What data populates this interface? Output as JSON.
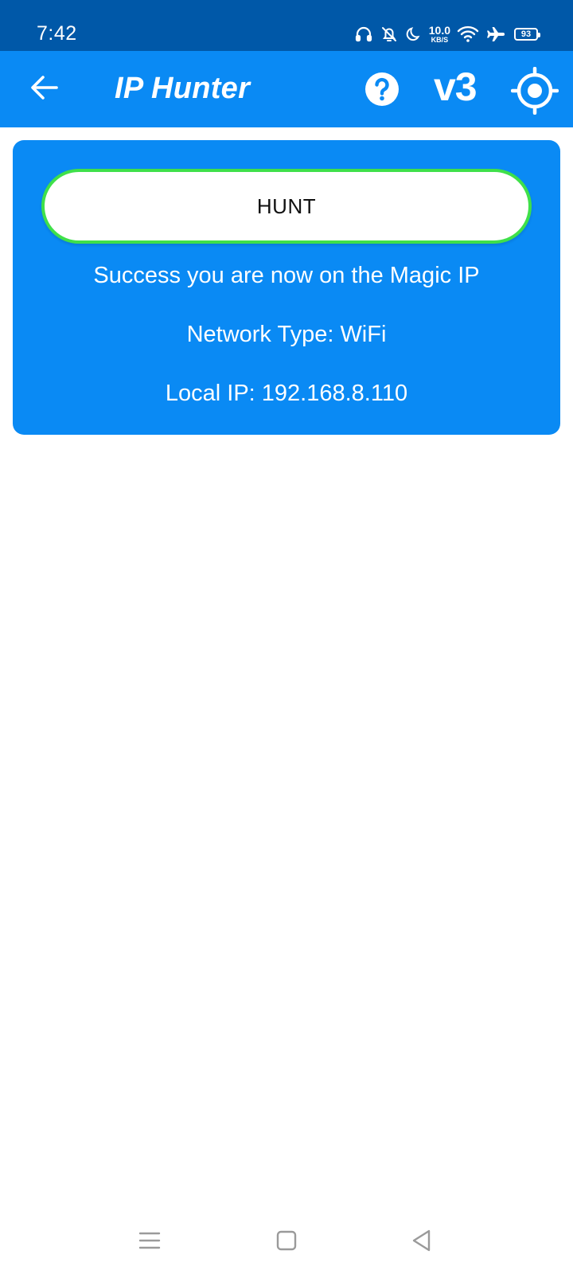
{
  "status_bar": {
    "time": "7:42",
    "net_speed_value": "10.0",
    "net_speed_unit": "KB/S",
    "battery_level": "93",
    "icons": [
      "headphones-icon",
      "bell-off-icon",
      "moon-icon",
      "net-speed-indicator",
      "wifi-icon",
      "airplane-icon",
      "battery-icon"
    ]
  },
  "app_bar": {
    "title": "IP Hunter",
    "version": "v3",
    "icons": [
      "back-arrow-icon",
      "help-icon",
      "crosshair-icon"
    ]
  },
  "card": {
    "hunt_label": "HUNT",
    "status_message": "Success you are now on the Magic IP",
    "network_type": "Network Type: WiFi",
    "local_ip": "Local IP: 192.168.8.110"
  },
  "nav_bar": {
    "icons": [
      "menu-icon",
      "home-square-icon",
      "back-triangle-icon"
    ]
  },
  "colors": {
    "status_bar_bg": "#0058a8",
    "primary": "#0a8af4",
    "hunt_border": "#3fe04a",
    "background": "#ffffff"
  }
}
